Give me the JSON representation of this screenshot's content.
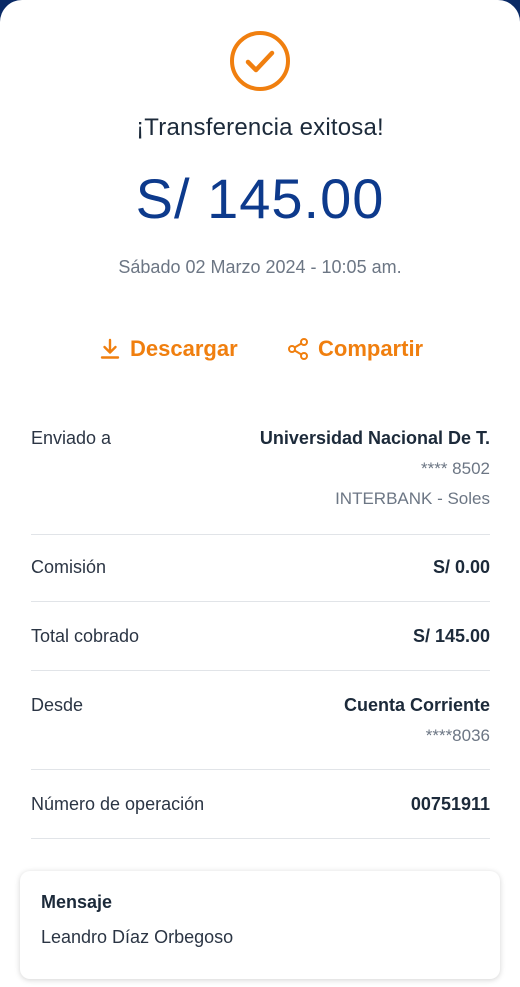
{
  "icons": {
    "success": "check-circle-icon",
    "download": "download-icon",
    "share": "share-icon"
  },
  "colors": {
    "accent": "#f07f0f",
    "amount": "#0d3a8c",
    "header": "#0a2a66"
  },
  "receipt": {
    "title": "¡Transferencia exitosa!",
    "amount": "S/ 145.00",
    "date": "Sábado 02 Marzo 2024 - 10:05 am."
  },
  "actions": {
    "download_label": "Descargar",
    "share_label": "Compartir"
  },
  "details": {
    "sent_to": {
      "label": "Enviado a",
      "name": "Universidad Nacional De T.",
      "account": "**** 8502",
      "bank": "INTERBANK - Soles"
    },
    "commission": {
      "label": "Comisión",
      "value": "S/ 0.00"
    },
    "total": {
      "label": "Total cobrado",
      "value": "S/ 145.00"
    },
    "from": {
      "label": "Desde",
      "account_type": "Cuenta Corriente",
      "account": "****8036"
    },
    "operation": {
      "label": "Número de operación",
      "value": "00751911"
    }
  },
  "message": {
    "title": "Mensaje",
    "body": "Leandro Díaz Orbegoso"
  }
}
